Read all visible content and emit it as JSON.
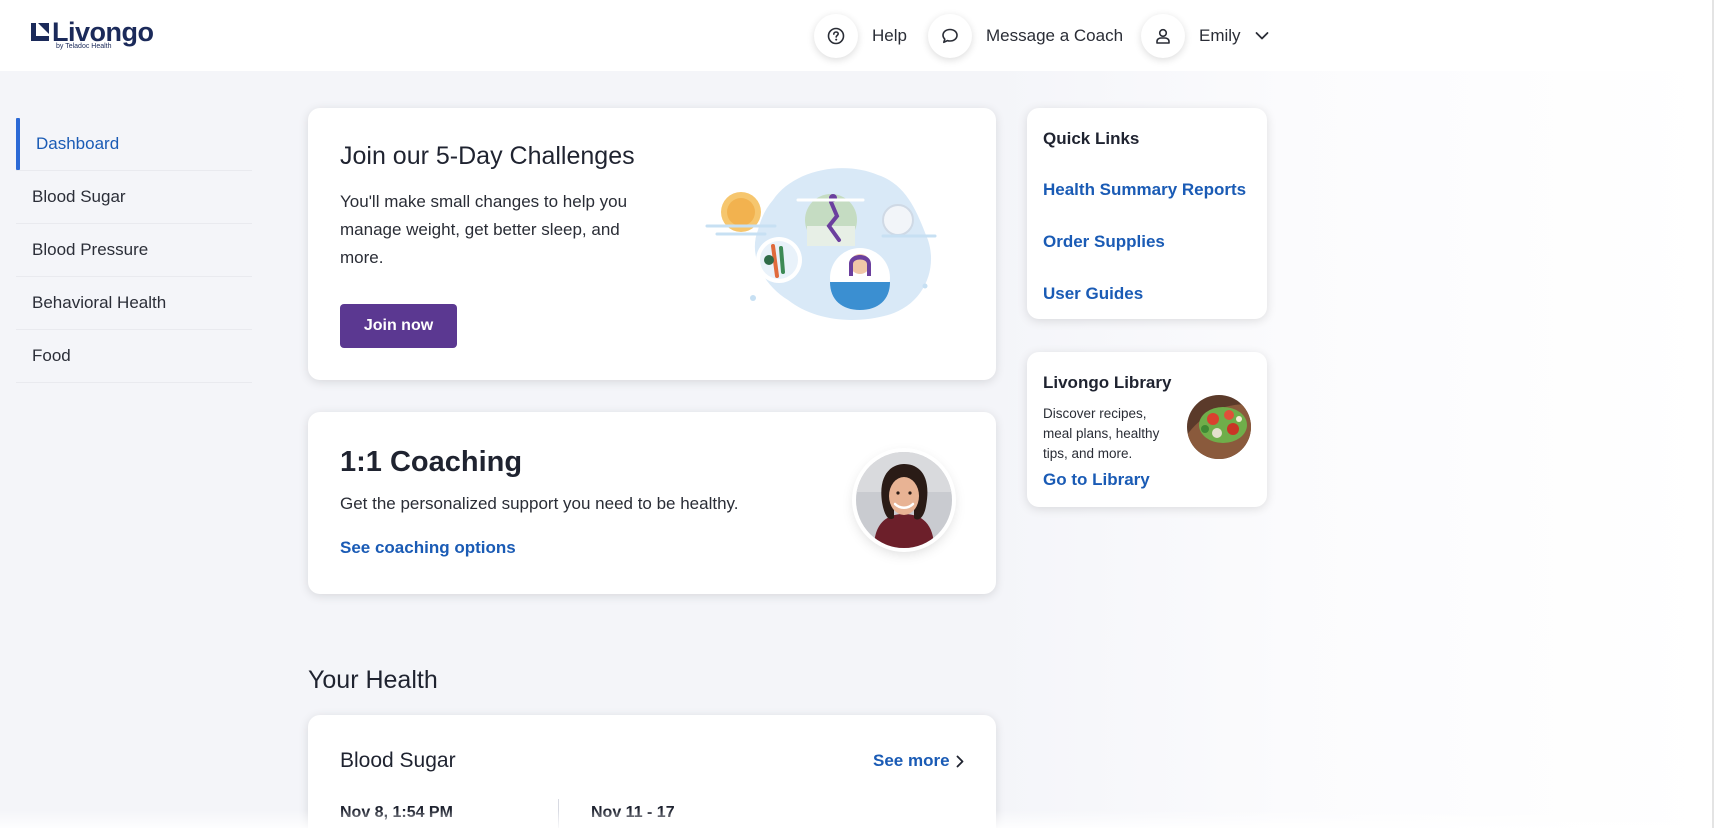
{
  "header": {
    "logo_text": "Livongo",
    "logo_sub": "by Teladoc Health",
    "help_label": "Help",
    "message_label": "Message a Coach",
    "user_name": "Emily"
  },
  "sidebar": {
    "items": [
      {
        "label": "Dashboard",
        "active": true
      },
      {
        "label": "Blood Sugar"
      },
      {
        "label": "Blood Pressure"
      },
      {
        "label": "Behavioral Health"
      },
      {
        "label": "Food"
      }
    ]
  },
  "challenge_card": {
    "title": "Join our 5-Day Challenges",
    "body": "You'll make small changes to help you manage weight, get better sleep, and more.",
    "button_label": "Join now"
  },
  "coaching_card": {
    "title": "1:1 Coaching",
    "body": "Get the personalized support you need to be healthy.",
    "link_label": "See coaching options"
  },
  "your_health": {
    "section_title": "Your Health",
    "blood_sugar": {
      "title": "Blood Sugar",
      "see_more": "See more",
      "col1_label": "Nov 8, 1:54 PM",
      "col2_label": "Nov 11 - 17"
    }
  },
  "quick_links": {
    "title": "Quick Links",
    "links": [
      "Health Summary Reports",
      "Order Supplies",
      "User Guides"
    ]
  },
  "library": {
    "title": "Livongo Library",
    "body": "Discover recipes, meal plans, healthy tips, and more.",
    "link_label": "Go to Library"
  },
  "colors": {
    "accent_blue": "#1a5bb5",
    "brand_purple": "#5b3891",
    "logo_navy": "#1b2a5a"
  }
}
